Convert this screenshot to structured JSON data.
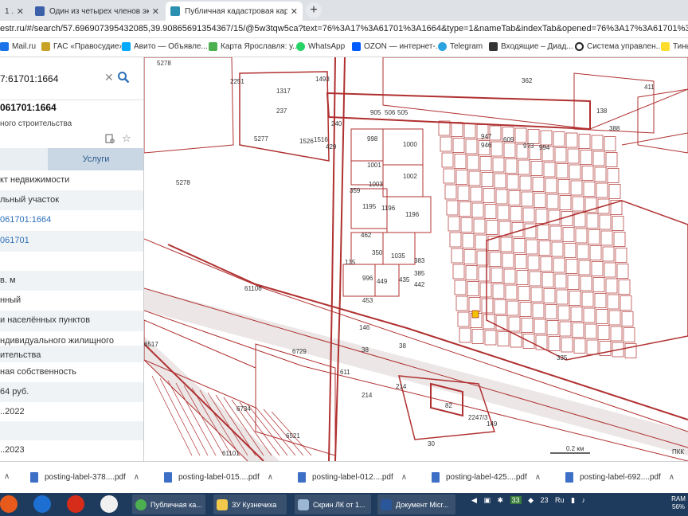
{
  "browser": {
    "tabs": [
      {
        "title": "1 .",
        "active": false
      },
      {
        "title": "Один из четырех членов экипа",
        "active": false
      },
      {
        "title": "Публичная кадастровая карта",
        "active": true
      }
    ],
    "new_tab": "+",
    "url": "estr.ru/#/search/57.696907395432085,39.90865691354367/15/@5w3tqw5ca?text=76%3A17%3A61701%3A1664&type=1&nameTab&indexTab&opened=76%3A17%3A61701%3A1664",
    "bookmarks": [
      "Mail.ru",
      "ГАС «Правосудие»",
      "Авито — Объявле...",
      "Карта Ярославля: у...",
      "WhatsApp",
      "OZON — интернет-...",
      "Telegram",
      "Входящие – Диад...",
      "Система управлен...",
      "Тинь"
    ]
  },
  "sidebar": {
    "search": {
      "value": "7:61701:1664"
    },
    "object_number": "061701:1664",
    "object_subtitle": "ного строительства",
    "tabs": {
      "services": "Услуги"
    },
    "rows": [
      {
        "text": "кт недвижимости",
        "link": false
      },
      {
        "text": "льный участок",
        "link": false
      },
      {
        "text": "061701:1664",
        "link": true
      },
      {
        "text": "061701",
        "link": true
      },
      {
        "text": "",
        "link": false
      },
      {
        "text": "в. м",
        "link": false
      },
      {
        "text": "нный",
        "link": false
      },
      {
        "text": "и населённых пунктов",
        "link": false
      },
      {
        "text": "ндивидуального жилищного",
        "link": false
      },
      {
        "text": "ительства",
        "link": false
      },
      {
        "text": "ная собственность",
        "link": false
      },
      {
        "text": "64 руб.",
        "link": false
      },
      {
        "text": "..2022",
        "link": false
      },
      {
        "text": "",
        "link": false
      },
      {
        "text": "..2023",
        "link": false
      }
    ]
  },
  "map": {
    "line_color": "#b03030",
    "road_color": "#c9b8b8",
    "highlight_color": "#f2c200",
    "labels": [
      "5278",
      "2251",
      "1317",
      "237",
      "240",
      "1526",
      "1516",
      "429",
      "5277",
      "1493",
      "905",
      "506",
      "505",
      "998",
      "1000",
      "1001",
      "1002",
      "1003",
      "1195",
      "1196",
      "1196",
      "5278",
      "462",
      "350",
      "1035",
      "383",
      "385",
      "442",
      "996",
      "449",
      "435",
      "453",
      "146",
      "362",
      "411",
      "138",
      "388",
      "947",
      "946",
      "609",
      "973",
      "994",
      "61106",
      "6517",
      "6729",
      "214",
      "214",
      "82",
      "2247/3",
      "149",
      "30",
      "6734",
      "6521",
      "61101",
      "335",
      "38",
      "38",
      "611",
      "135",
      "359",
      "0.2 км",
      "ПКК"
    ]
  },
  "downloads": [
    {
      "name": "posting-label-378....pdf"
    },
    {
      "name": "posting-label-015....pdf"
    },
    {
      "name": "posting-label-012....pdf"
    },
    {
      "name": "posting-label-425....pdf"
    },
    {
      "name": "posting-label-692....pdf"
    }
  ],
  "taskbar": {
    "windows": [
      {
        "title": "Публичная ка..."
      },
      {
        "title": "ЗУ Кузнечиха"
      },
      {
        "title": "Скрин ЛК от 1..."
      },
      {
        "title": "Документ Micr..."
      }
    ],
    "tray": [
      "33",
      "23",
      "Ru"
    ],
    "ram": {
      "label": "RAM",
      "value": "56%"
    }
  }
}
